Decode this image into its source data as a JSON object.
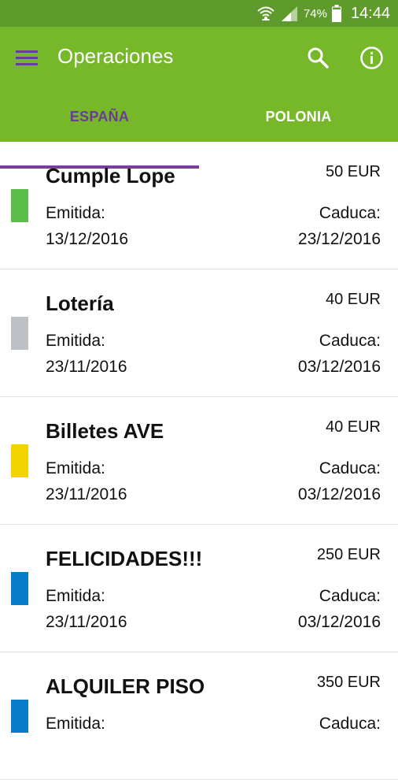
{
  "status_bar": {
    "battery": "74%",
    "time": "14:44"
  },
  "app_bar": {
    "title": "Operaciones",
    "icons": [
      "menu-icon",
      "search-icon",
      "info-icon"
    ]
  },
  "tabs": [
    {
      "label": "ESPAÑA",
      "selected": true
    },
    {
      "label": "POLONIA",
      "selected": false
    }
  ],
  "colors": {
    "primary": "#76b82a",
    "status_bar": "#5e9a2c",
    "accent": "#7a3e9d"
  },
  "operations": [
    {
      "title": "Cumple Lope",
      "amount": "50 EUR",
      "emit_label": "Emitida:",
      "emit_date": "13/12/2016",
      "exp_label": "Caduca:",
      "exp_date": "23/12/2016",
      "color": "#5cbd4a"
    },
    {
      "title": "Lotería",
      "amount": "40 EUR",
      "emit_label": "Emitida:",
      "emit_date": "23/11/2016",
      "exp_label": "Caduca:",
      "exp_date": "03/12/2016",
      "color": "#bdc1c6"
    },
    {
      "title": "Billetes AVE",
      "amount": "40 EUR",
      "emit_label": "Emitida:",
      "emit_date": "23/11/2016",
      "exp_label": "Caduca:",
      "exp_date": "03/12/2016",
      "color": "#f2d500"
    },
    {
      "title": "FELICIDADES!!!",
      "amount": "250 EUR",
      "emit_label": "Emitida:",
      "emit_date": "23/11/2016",
      "exp_label": "Caduca:",
      "exp_date": "03/12/2016",
      "color": "#0a7bc7"
    },
    {
      "title": "ALQUILER PISO",
      "amount": "350 EUR",
      "emit_label": "Emitida:",
      "emit_date": "",
      "exp_label": "Caduca:",
      "exp_date": "",
      "color": "#0a7bc7"
    }
  ]
}
